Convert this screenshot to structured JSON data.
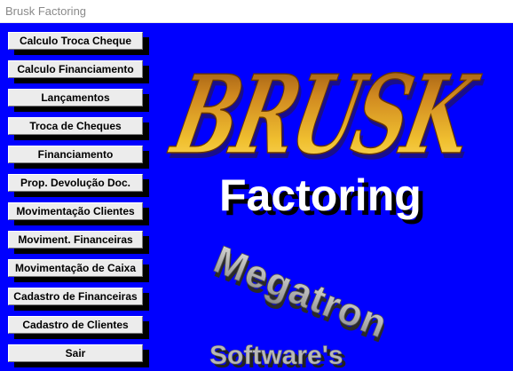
{
  "window": {
    "title": "Brusk Factoring"
  },
  "menu": {
    "items": [
      {
        "label": "Calculo Troca Cheque"
      },
      {
        "label": "Calculo Financiamento"
      },
      {
        "label": "Lançamentos"
      },
      {
        "label": "Troca de Cheques"
      },
      {
        "label": "Financiamento"
      },
      {
        "label": "Prop. Devolução Doc."
      },
      {
        "label": "Movimentação Clientes"
      },
      {
        "label": "Moviment. Financeiras"
      },
      {
        "label": "Movimentação de Caixa"
      },
      {
        "label": "Cadastro de Financeiras"
      },
      {
        "label": "Cadastro de Clientes"
      },
      {
        "label": "Sair"
      }
    ]
  },
  "branding": {
    "brand": "BRUSK",
    "product": "Factoring",
    "company": "Megatron",
    "company_suffix": "Software's",
    "colors": {
      "background": "#0000FF",
      "brand_gold": "#E8B020",
      "product_white": "#FFFFFF",
      "company_gray": "#B0B0B0"
    }
  }
}
